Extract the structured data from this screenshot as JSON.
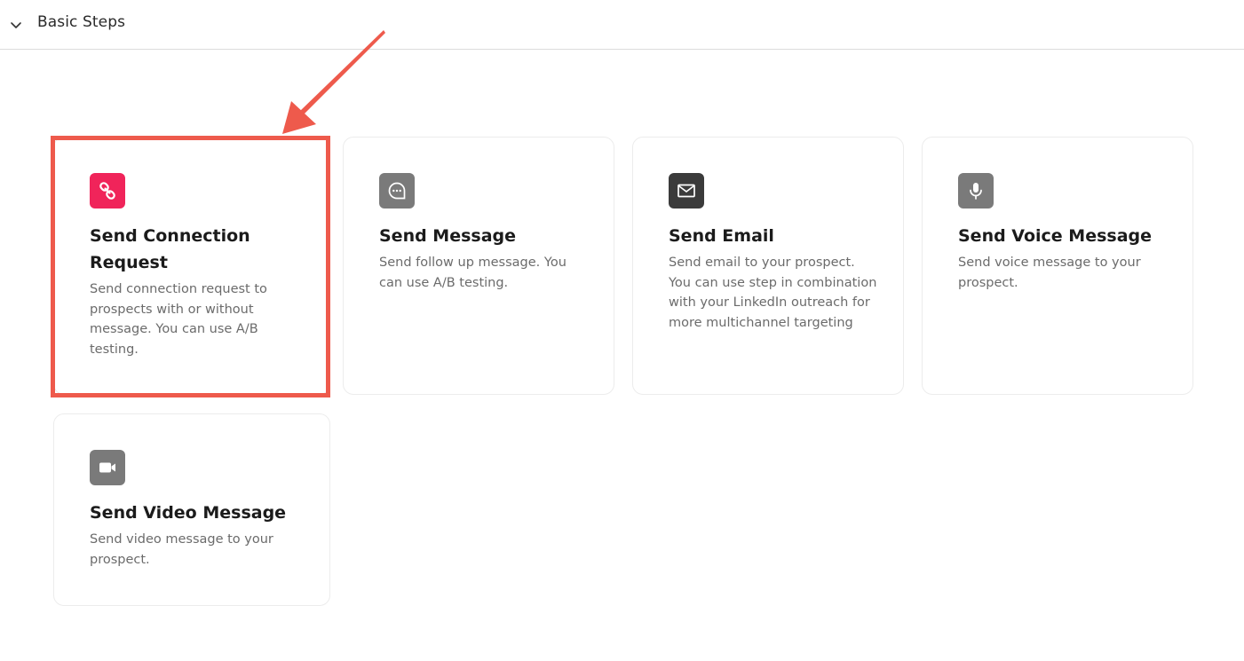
{
  "section": {
    "title": "Basic Steps",
    "expanded": true
  },
  "colors": {
    "annotation": "#ee5a4c",
    "connection_icon_bg": "#f0245a",
    "message_icon_bg": "#7a7a7a",
    "email_icon_bg": "#3b3b3b",
    "voice_icon_bg": "#7a7a7a",
    "video_icon_bg": "#7a7a7a"
  },
  "steps": [
    {
      "id": "connection",
      "icon": "link-icon",
      "title": "Send Connection Request",
      "description": "Send connection request to prospects with or without message. You can use A/B testing.",
      "highlighted": true
    },
    {
      "id": "message",
      "icon": "chat-bubble-icon",
      "title": "Send Message",
      "description": "Send follow up message. You can use A/B testing."
    },
    {
      "id": "email",
      "icon": "envelope-icon",
      "title": "Send Email",
      "description": "Send email to your prospect. You can use step in combination with your LinkedIn outreach for more multichannel targeting"
    },
    {
      "id": "voice",
      "icon": "microphone-icon",
      "title": "Send Voice Message",
      "description": "Send voice message to your prospect."
    },
    {
      "id": "video",
      "icon": "video-camera-icon",
      "title": "Send Video Message",
      "description": "Send video message to your prospect."
    }
  ]
}
